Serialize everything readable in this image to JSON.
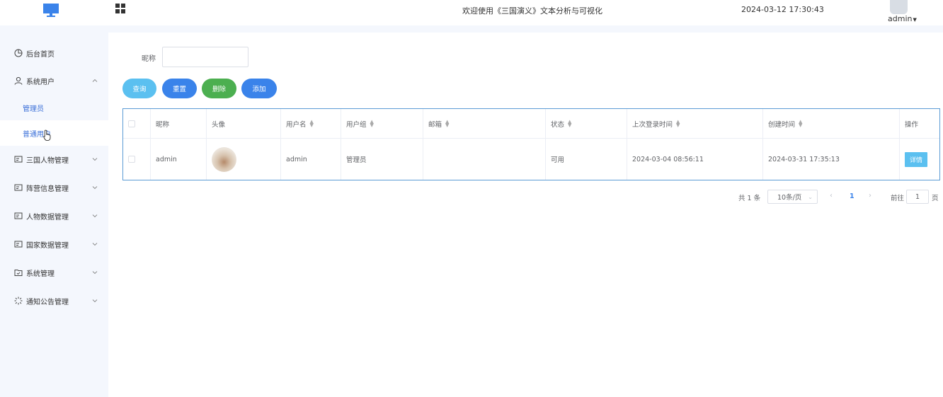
{
  "header": {
    "title": "欢迎使用《三国演义》文本分析与可视化",
    "datetime": "2024-03-12 17:30:43",
    "user": "admin"
  },
  "sidebar": {
    "items": [
      {
        "label": "后台首页",
        "icon": "clock-pie-icon"
      },
      {
        "label": "系统用户",
        "icon": "user-icon",
        "expanded": true,
        "children": [
          {
            "label": "管理员"
          },
          {
            "label": "普通用户",
            "active": true
          }
        ]
      },
      {
        "label": "三国人物管理",
        "icon": "card-icon"
      },
      {
        "label": "阵营信息管理",
        "icon": "card-icon"
      },
      {
        "label": "人物数据管理",
        "icon": "card-icon"
      },
      {
        "label": "国家数据管理",
        "icon": "card-icon"
      },
      {
        "label": "系统管理",
        "icon": "folder-check-icon"
      },
      {
        "label": "通知公告管理",
        "icon": "loading-star-icon"
      }
    ]
  },
  "filter": {
    "label": "昵称",
    "value": ""
  },
  "buttons": {
    "query": "查询",
    "reset": "重置",
    "delete": "删除",
    "add": "添加"
  },
  "table": {
    "headers": [
      "昵称",
      "头像",
      "用户名",
      "用户组",
      "邮箱",
      "状态",
      "上次登录时间",
      "创建时间",
      "操作"
    ],
    "rows": [
      {
        "nickname": "admin",
        "username": "admin",
        "group": "管理员",
        "email": "",
        "status": "可用",
        "last_login": "2024-03-04 08:56:11",
        "created": "2024-03-31 17:35:13",
        "action": "详情"
      }
    ]
  },
  "pager": {
    "total": "共 1 条",
    "size": "10条/页",
    "page": "1",
    "goto": "前往",
    "goto_value": "1",
    "page_suffix": "页"
  },
  "colors": {
    "primary": "#3a83ea",
    "info": "#5bc0f0",
    "success": "#4caf50",
    "sidebar_bg": "#f4f7fd"
  }
}
